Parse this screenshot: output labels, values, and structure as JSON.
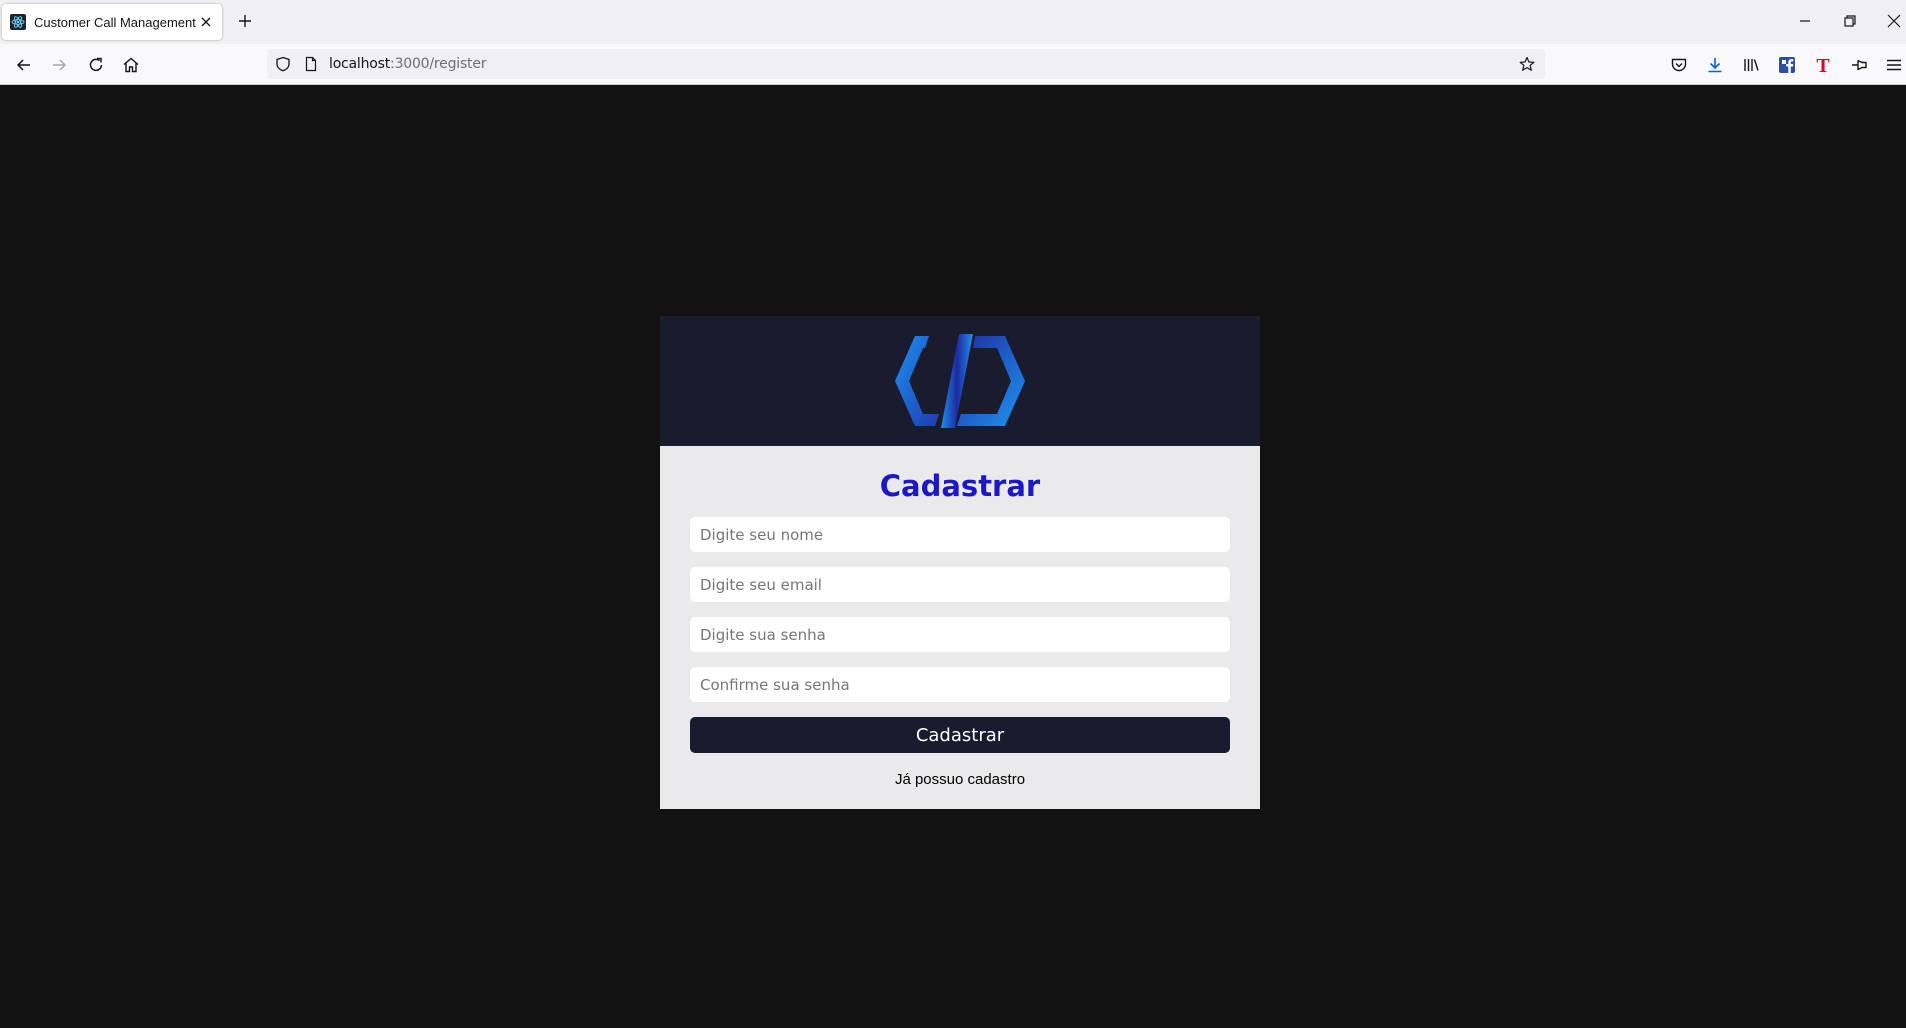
{
  "browser": {
    "tab_title": "Customer Call Management",
    "url_host": "localhost",
    "url_rest": ":3000/register"
  },
  "icons": {
    "favicon": "react-icon",
    "tab_close": "close-icon",
    "new_tab": "plus-icon",
    "back": "arrow-left-icon",
    "forward": "arrow-right-icon",
    "reload": "reload-icon",
    "home": "home-icon",
    "shield": "shield-icon",
    "page": "page-icon",
    "bookmark": "star-icon",
    "pocket": "pocket-icon",
    "downloads": "download-icon",
    "library": "library-icon",
    "facebook": "facebook-icon",
    "extension_t": "t-extension-icon",
    "pin": "pin-icon",
    "menu": "hamburger-icon"
  },
  "colors": {
    "page_bg": "#121212",
    "card_header_bg": "#181c2e",
    "card_body_bg": "#eaeaec",
    "title_color": "#1c18c8",
    "button_bg": "#181c2e",
    "logo_gradient": [
      "#1e2a9e",
      "#1f8ff0"
    ]
  },
  "form": {
    "title": "Cadastrar",
    "name_placeholder": "Digite seu nome",
    "email_placeholder": "Digite seu email",
    "password_placeholder": "Digite sua senha",
    "confirm_placeholder": "Confirme sua senha",
    "submit_label": "Cadastrar",
    "login_link": "Já possuo cadastro"
  }
}
